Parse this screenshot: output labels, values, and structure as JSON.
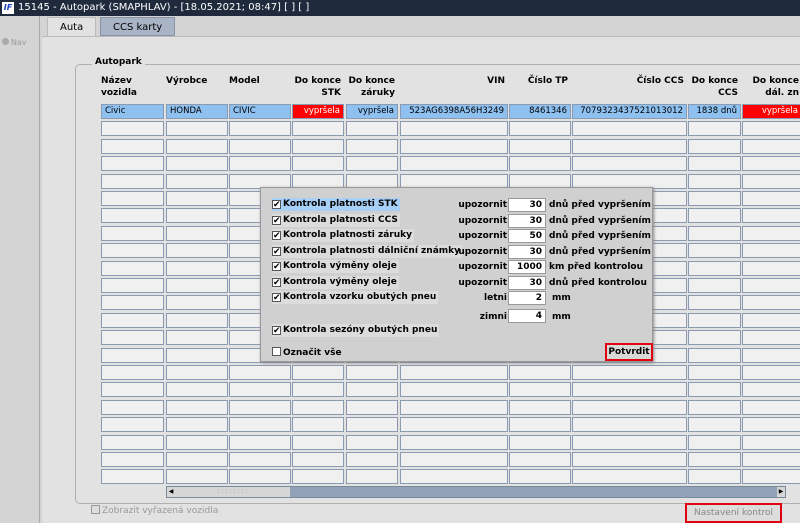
{
  "window": {
    "logo": "IF",
    "title": "15145 - Autopark (SMAPHLAV) - [18.05.2021; 08:47] [ ] [ ]"
  },
  "nav": {
    "label": "Nav"
  },
  "tabs": [
    {
      "label": "Auta"
    },
    {
      "label": "CCS karty"
    }
  ],
  "group": {
    "label": "Autopark"
  },
  "columns": [
    {
      "label": "Název\nvozidla"
    },
    {
      "label": "Výrobce"
    },
    {
      "label": "Model"
    },
    {
      "label": "Do konce\nSTK"
    },
    {
      "label": "Do konce\nzáruky"
    },
    {
      "label": "VIN"
    },
    {
      "label": "Číslo TP"
    },
    {
      "label": "Číslo CCS"
    },
    {
      "label": "Do konce\nCCS"
    },
    {
      "label": "Do konce\ndál. zn"
    }
  ],
  "rows": [
    [
      "Civic",
      "HONDA",
      "CIVIC",
      "vypršela",
      "vypršela",
      "523AG6398A56H3249",
      "8461346",
      "7079323437521013012",
      "1838 dnů",
      "vypršela"
    ]
  ],
  "dialog": {
    "checks": [
      {
        "label": "Kontrola platnosti STK",
        "checked": true,
        "prefix": "upozornit",
        "value": "30",
        "unit": "dnů před vypršením"
      },
      {
        "label": "Kontrola platnosti CCS",
        "checked": true,
        "prefix": "upozornit",
        "value": "30",
        "unit": "dnů před vypršením"
      },
      {
        "label": "Kontrola platnosti záruky",
        "checked": true,
        "prefix": "upozornit",
        "value": "50",
        "unit": "dnů před vypršením"
      },
      {
        "label": "Kontrola platnosti dálniční známky",
        "checked": true,
        "prefix": "upozornit",
        "value": "30",
        "unit": "dnů před vypršením"
      },
      {
        "label": "Kontrola výměny oleje",
        "checked": true,
        "prefix": "upozornit",
        "value": "1000",
        "unit": "km před kontrolou"
      },
      {
        "label": "Kontrola výměny oleje",
        "checked": true,
        "prefix": "upozornit",
        "value": "30",
        "unit": "dnů před kontrolou"
      },
      {
        "label": "Kontrola vzorku obutých pneu",
        "checked": true,
        "prefix": "letni",
        "value": "2",
        "unit": "mm"
      }
    ],
    "winter": {
      "prefix": "zimni",
      "value": "4",
      "unit": "mm"
    },
    "season": {
      "label": "Kontrola sezóny obutých pneu",
      "checked": true
    },
    "select_all": {
      "label": "Označit vše",
      "checked": false
    },
    "confirm": "Potvrdit"
  },
  "footer": {
    "show_retired": "Zobrazit vyřazená vozidla",
    "settings": "Nastavení kontrol"
  },
  "colors": {
    "selected": "#8ec0f0",
    "expired": "#ff0000",
    "highlight": "#e00010"
  }
}
